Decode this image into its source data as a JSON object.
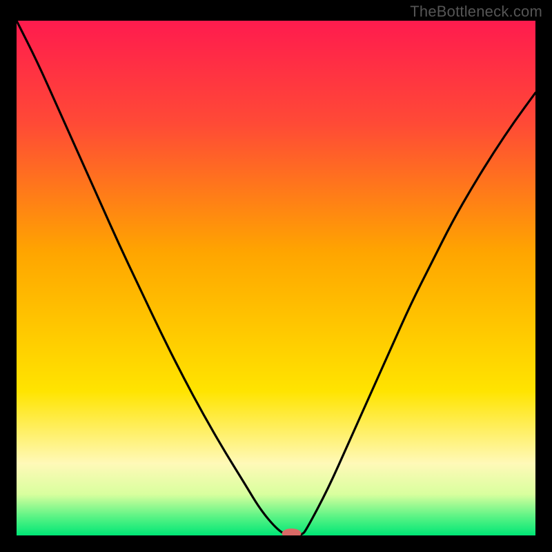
{
  "watermark": "TheBottleneck.com",
  "chart_data": {
    "type": "line",
    "title": "",
    "xlabel": "",
    "ylabel": "",
    "xlim": [
      0,
      100
    ],
    "ylim": [
      0,
      100
    ],
    "background_gradient": {
      "stops": [
        {
          "pos": 0.0,
          "color": "#ff1b4e"
        },
        {
          "pos": 0.2,
          "color": "#ff4a36"
        },
        {
          "pos": 0.45,
          "color": "#ffa500"
        },
        {
          "pos": 0.72,
          "color": "#ffe400"
        },
        {
          "pos": 0.86,
          "color": "#fff9b8"
        },
        {
          "pos": 0.92,
          "color": "#d9ff9e"
        },
        {
          "pos": 0.965,
          "color": "#56f384"
        },
        {
          "pos": 1.0,
          "color": "#00e676"
        }
      ]
    },
    "series": [
      {
        "name": "bottleneck-curve",
        "x": [
          0,
          4,
          8,
          12,
          16,
          20,
          24,
          28,
          32,
          36,
          40,
          44,
          47,
          50,
          52,
          55,
          56,
          60,
          64,
          68,
          72,
          76,
          80,
          84,
          88,
          92,
          96,
          100
        ],
        "y": [
          100,
          92,
          83,
          74,
          65,
          56,
          47.5,
          39,
          31,
          23.5,
          16.5,
          10,
          5,
          1.4,
          0,
          0,
          1.4,
          9,
          18,
          27,
          36,
          45,
          53,
          61,
          68,
          74.5,
          80.5,
          86
        ]
      }
    ],
    "marker": {
      "name": "optimal-point",
      "x": 53,
      "y": 0.4,
      "color": "#d96a66",
      "rx": 14,
      "ry": 7
    }
  }
}
